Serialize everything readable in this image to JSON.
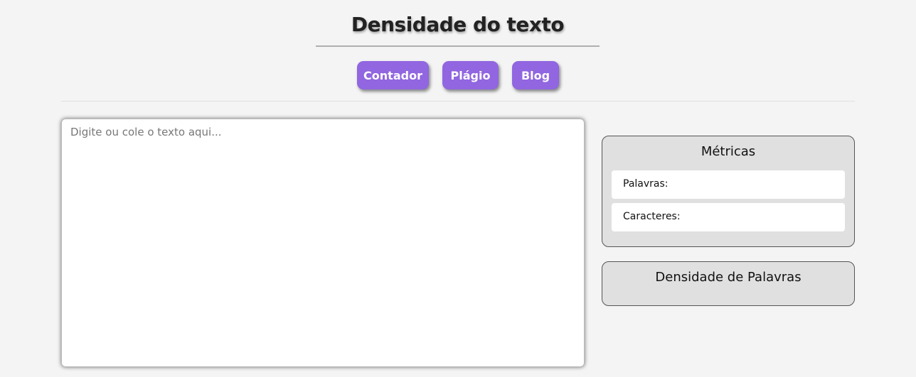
{
  "header": {
    "title": "Densidade do texto"
  },
  "nav": {
    "items": [
      {
        "label": "Contador"
      },
      {
        "label": "Plágio"
      },
      {
        "label": "Blog"
      }
    ]
  },
  "editor": {
    "placeholder": "Digite ou cole o texto aqui...",
    "value": ""
  },
  "metrics": {
    "title": "Métricas",
    "words_label": "Palavras:",
    "chars_label": "Caracteres:"
  },
  "density": {
    "title": "Densidade de Palavras"
  },
  "colors": {
    "accent": "#9166e0",
    "background": "#f4f4f4",
    "panel": "#e0e0e0"
  }
}
